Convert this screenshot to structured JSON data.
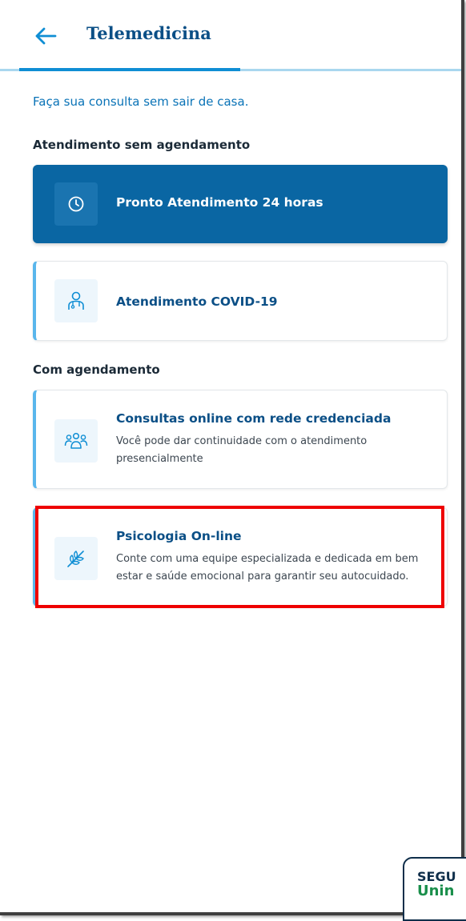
{
  "header": {
    "title": "Telemedicina",
    "back_icon": "arrow-left-icon"
  },
  "subtitle": "Faça sua consulta sem sair de casa.",
  "sections": {
    "no_appointment": {
      "label": "Atendimento sem agendamento",
      "cards": [
        {
          "title": "Pronto Atendimento 24 horas",
          "icon": "clock-icon"
        },
        {
          "title": "Atendimento COVID-19",
          "icon": "doctor-icon"
        }
      ]
    },
    "with_appointment": {
      "label": "Com agendamento",
      "cards": [
        {
          "title": "Consultas online com rede credenciada",
          "description": "Você pode dar continuidade com o atendimento presencialmente",
          "icon": "group-icon"
        },
        {
          "title": "Psicologia On-line",
          "description": "Conte com uma equipe especializada e dedicada em bem estar e saúde emocional para garantir seu autocuidado.",
          "icon": "leaf-icon"
        }
      ]
    }
  },
  "logo": {
    "line1": "SEGU",
    "line2": "Unin"
  },
  "colors": {
    "primary": "#0a66a3",
    "accent": "#59b6ec",
    "title_blue": "#0b4f86",
    "highlight": "#ee0000",
    "logo_green": "#1a8f4b"
  }
}
